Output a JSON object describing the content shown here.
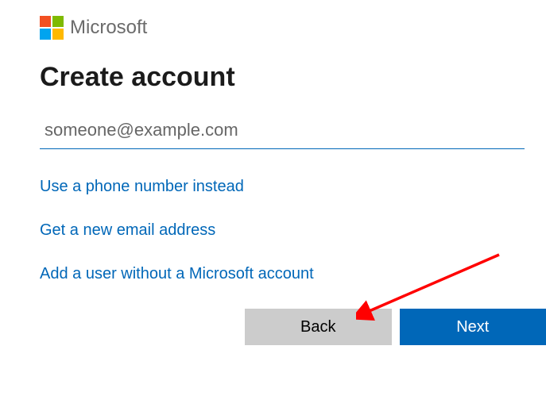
{
  "brand": "Microsoft",
  "title": "Create account",
  "email_placeholder": "someone@example.com",
  "links": {
    "phone": "Use a phone number instead",
    "new_email": "Get a new email address",
    "no_account": "Add a user without a Microsoft account"
  },
  "buttons": {
    "back": "Back",
    "next": "Next"
  },
  "colors": {
    "accent": "#0067b8",
    "back_btn": "#cccccc",
    "arrow": "#ff0000"
  }
}
